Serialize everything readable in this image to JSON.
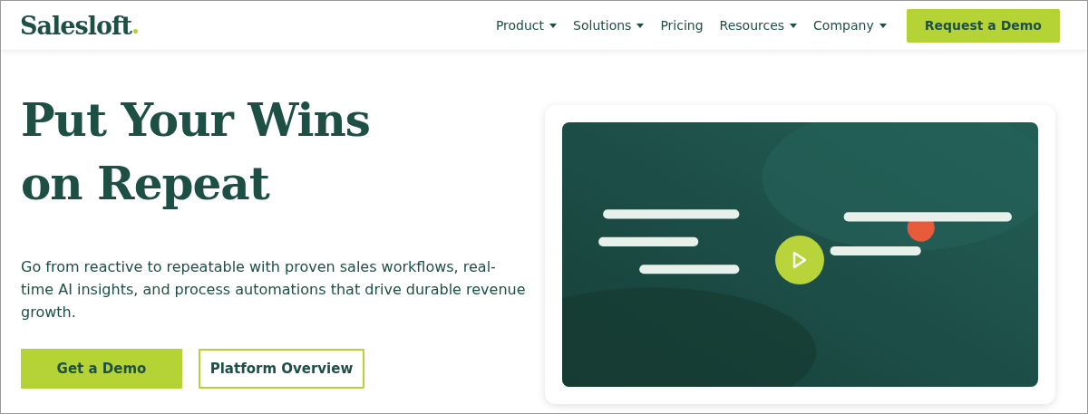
{
  "header": {
    "logo": "Salesloft",
    "nav": [
      {
        "label": "Product",
        "has_menu": true
      },
      {
        "label": "Solutions",
        "has_menu": true
      },
      {
        "label": "Pricing",
        "has_menu": false
      },
      {
        "label": "Resources",
        "has_menu": true
      },
      {
        "label": "Company",
        "has_menu": true
      }
    ],
    "cta": "Request a Demo"
  },
  "hero": {
    "headline": "Put Your Wins on Repeat",
    "description": "Go from reactive to repeatable with proven sales workflows, real-time AI insights, and process automations that drive durable revenue growth.",
    "buttons": [
      {
        "label": "Get a Demo",
        "kind": "primary"
      },
      {
        "label": "Platform Overview",
        "kind": "outline"
      }
    ]
  }
}
